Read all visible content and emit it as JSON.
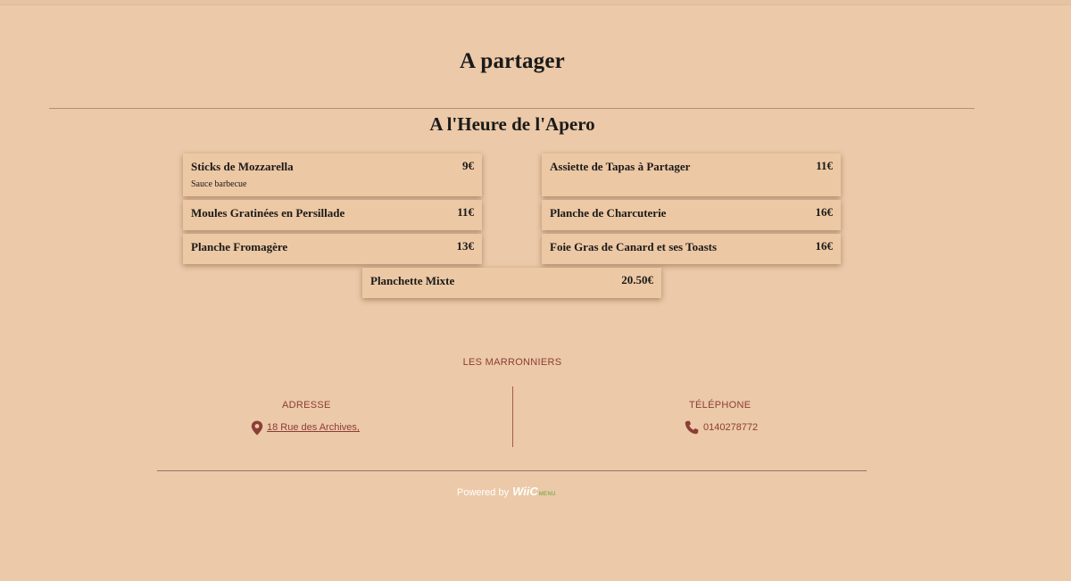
{
  "page": {
    "section_title": "A partager",
    "sub_title": "A l'Heure de l'Apero"
  },
  "menu_items": [
    {
      "name": "Sticks de Mozzarella",
      "price": "9€",
      "description": "Sauce barbecue"
    },
    {
      "name": "Assiette de Tapas à Partager",
      "price": "11€"
    },
    {
      "name": "Moules Gratinées en Persillade",
      "price": "11€"
    },
    {
      "name": "Planche de Charcuterie",
      "price": "16€"
    },
    {
      "name": "Planche Fromagère",
      "price": "13€"
    },
    {
      "name": "Foie Gras de Canard et ses Toasts",
      "price": "16€"
    },
    {
      "name": "Planchette Mixte",
      "price": "20.50€"
    }
  ],
  "footer": {
    "brand_name": "LES MARRONNIERS",
    "address_label": "ADRESSE",
    "address_value": "18 Rue des Archives,",
    "address_icon": "map-pin-icon",
    "phone_label": "TÉLÉPHONE",
    "phone_value": "0140278772",
    "phone_icon": "phone-icon",
    "powered_text": "Powered by",
    "logo_main": "WiiC",
    "logo_sub": "MENU"
  },
  "colors": {
    "background": "#ecc9a8",
    "accent": "#8c3d36",
    "logo_green": "#5ea23a"
  }
}
